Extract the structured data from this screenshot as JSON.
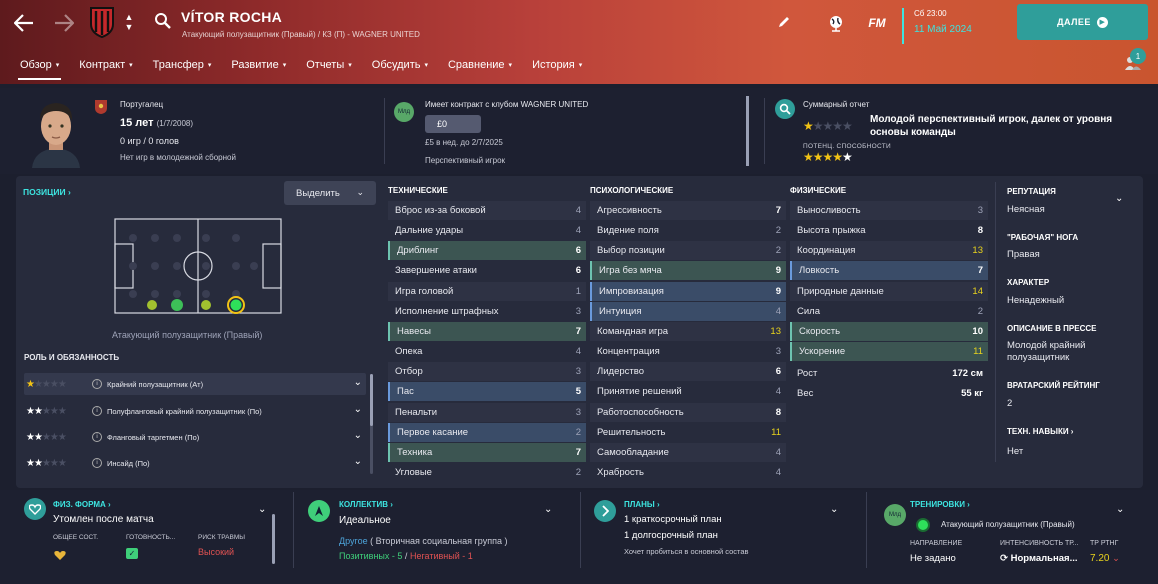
{
  "header": {
    "player_name": "VÍTOR ROCHA",
    "subtitle": "Атакующий полузащитник (Правый) / КЗ (П) - WAGNER UNITED",
    "fm_logo": "FM",
    "date_day": "Сб 23:00",
    "date": "11 Май 2024",
    "continue_label": "ДАЛЕЕ",
    "group_badge": "1",
    "icons": [
      "back-arrow-icon",
      "forward-arrow-icon",
      "club-crest-icon",
      "search-icon",
      "pencil-icon",
      "globe-icon",
      "play-circle-icon",
      "people-icon"
    ]
  },
  "nav": [
    {
      "label": "Обзор",
      "active": true
    },
    {
      "label": "Контракт"
    },
    {
      "label": "Трансфер"
    },
    {
      "label": "Развитие"
    },
    {
      "label": "Отчеты"
    },
    {
      "label": "Обсудить"
    },
    {
      "label": "Сравнение"
    },
    {
      "label": "История"
    }
  ],
  "info": {
    "nationality": "Португалец",
    "age": "15 лет",
    "birth_date": "(1/7/2008)",
    "games": "0 игр / 0 голов",
    "youth": "Нет игр в молодежной сборной",
    "contract_badge": "Млд",
    "contract": "Имеет контракт с клубом WAGNER UNITED",
    "wage": "£0",
    "wage_line": "£5 в нед. до 2/7/2025",
    "prospect": "Перспективный игрок",
    "report_title": "Суммарный отчет",
    "report_text": "Молодой перспективный игрок, далек от уровня основы команды",
    "current_ability_stars": 1,
    "potential_label": "ПОТЕНЦ. СПОСОБНОСТИ",
    "potential_stars": 4.5
  },
  "positions": {
    "label": "ПОЗИЦИИ",
    "select_label": "Выделить",
    "position_label": "Атакующий полузащитник (Правый)",
    "role_title": "РОЛЬ И ОБЯЗАННОСТЬ",
    "roles": [
      {
        "name": "Крайний полузащитник (Ат)",
        "stars": 1,
        "selected": true
      },
      {
        "name": "Полуфланговый крайний полузащитник (По)",
        "stars": 2.5
      },
      {
        "name": "Фланговый таргетмен (По)",
        "stars": 2.5
      },
      {
        "name": "Инсайд (По)",
        "stars": 2.5
      }
    ]
  },
  "attributes": {
    "technical": {
      "title": "ТЕХНИЧЕСКИЕ",
      "rows": [
        {
          "name": "Вброс из-за боковой",
          "value": "4"
        },
        {
          "name": "Дальние удары",
          "value": "4"
        },
        {
          "name": "Дриблинг",
          "value": "6",
          "hl": "g"
        },
        {
          "name": "Завершение атаки",
          "value": "6"
        },
        {
          "name": "Игра головой",
          "value": "1"
        },
        {
          "name": "Исполнение штрафных",
          "value": "3"
        },
        {
          "name": "Навесы",
          "value": "7",
          "hl": "g"
        },
        {
          "name": "Опека",
          "value": "4"
        },
        {
          "name": "Отбор",
          "value": "3"
        },
        {
          "name": "Пас",
          "value": "5",
          "hl": "b"
        },
        {
          "name": "Пенальти",
          "value": "3"
        },
        {
          "name": "Первое касание",
          "value": "2",
          "hl": "b"
        },
        {
          "name": "Техника",
          "value": "7",
          "hl": "g"
        },
        {
          "name": "Угловые",
          "value": "2"
        }
      ]
    },
    "mental": {
      "title": "ПСИХОЛОГИЧЕСКИЕ",
      "rows": [
        {
          "name": "Агрессивность",
          "value": "7"
        },
        {
          "name": "Видение поля",
          "value": "2"
        },
        {
          "name": "Выбор позиции",
          "value": "2"
        },
        {
          "name": "Игра без мяча",
          "value": "9",
          "hl": "g"
        },
        {
          "name": "Импровизация",
          "value": "9",
          "hl": "b"
        },
        {
          "name": "Интуиция",
          "value": "4",
          "hl": "b"
        },
        {
          "name": "Командная игра",
          "value": "13"
        },
        {
          "name": "Концентрация",
          "value": "3"
        },
        {
          "name": "Лидерство",
          "value": "6"
        },
        {
          "name": "Принятие решений",
          "value": "4"
        },
        {
          "name": "Работоспособность",
          "value": "8"
        },
        {
          "name": "Решительность",
          "value": "11"
        },
        {
          "name": "Самообладание",
          "value": "4"
        },
        {
          "name": "Храбрость",
          "value": "4"
        }
      ]
    },
    "physical": {
      "title": "ФИЗИЧЕСКИЕ",
      "rows": [
        {
          "name": "Выносливость",
          "value": "3"
        },
        {
          "name": "Высота прыжка",
          "value": "8"
        },
        {
          "name": "Координация",
          "value": "13"
        },
        {
          "name": "Ловкость",
          "value": "7",
          "hl": "b"
        },
        {
          "name": "Природные данные",
          "value": "14"
        },
        {
          "name": "Сила",
          "value": "2"
        },
        {
          "name": "Скорость",
          "value": "10",
          "hl": "g"
        },
        {
          "name": "Ускорение",
          "value": "11",
          "hl": "g"
        }
      ],
      "height_label": "Рост",
      "height": "172 см",
      "weight_label": "Вес",
      "weight": "55 кг"
    }
  },
  "side": {
    "reputation_label": "РЕПУТАЦИЯ",
    "reputation": "Неясная",
    "foot_label": "\"РАБОЧАЯ\" НОГА",
    "foot": "Правая",
    "character_label": "ХАРАКТЕР",
    "character": "Ненадежный",
    "press_label": "ОПИСАНИЕ В ПРЕССЕ",
    "press": "Молодой крайний полузащитник",
    "gk_label": "ВРАТАРСКИЙ РЕЙТИНГ",
    "gk": "2",
    "tech_label": "ТЕХН. НАВЫКИ",
    "tech": "Нет"
  },
  "bottom": {
    "fitness_label": "ФИЗ. ФОРМА",
    "fitness": "Утомлен после матча",
    "overall_label": "ОБЩЕЕ СОСТ.",
    "readiness_label": "ГОТОВНОСТЬ...",
    "injury_label": "РИСК ТРАВМЫ",
    "injury": "Высокий",
    "team_label": "КОЛЛЕКТИВ",
    "team": "Идеальное",
    "social_group": "Другое",
    "social_group_desc": "( Вторичная социальная группа )",
    "positive": "Позитивных - 5",
    "separator": "/",
    "negative": "Негативный - 1",
    "plans_label": "ПЛАНЫ",
    "plan_short": "1 краткосрочный план",
    "plan_long": "1 долгосрочный план",
    "plan_hint": "Хочет пробиться в основной состав",
    "training_label": "ТРЕНИРОВКИ",
    "training_badge": "Млд",
    "training_role": "Атакующий полузащитник (Правый)",
    "direction_label": "НАПРАВЛЕНИЕ",
    "direction": "Не задано",
    "intensity_label": "ИНТЕНСИВНОСТЬ ТР...",
    "intensity": "Нормальная...",
    "rating_label": "ТР РТНГ",
    "rating": "7.20"
  },
  "colors": {
    "accent": "#3de4e0",
    "teal_button": "#2f9e9a",
    "star": "#f2c315",
    "injury": "#e05252",
    "positive": "#3fcf7a",
    "negative": "#e05252"
  }
}
